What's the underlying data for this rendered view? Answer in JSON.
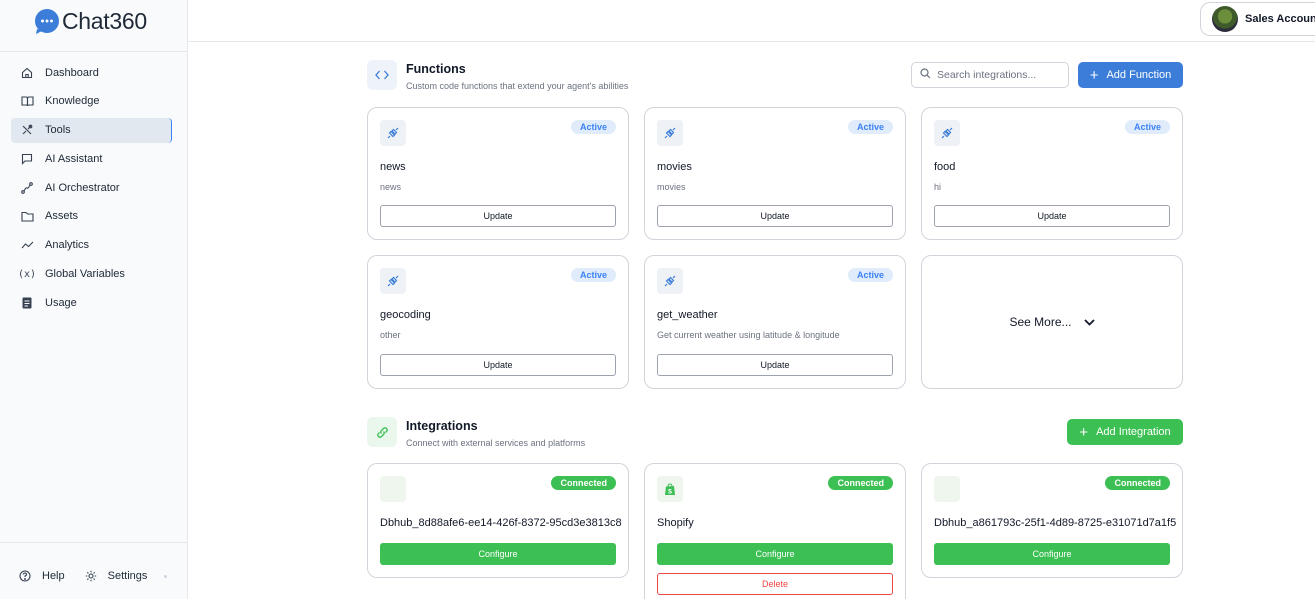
{
  "brand": {
    "name": "Chat360"
  },
  "sidebar": {
    "items": [
      {
        "label": "Dashboard",
        "icon": "home-icon"
      },
      {
        "label": "Knowledge",
        "icon": "book-icon"
      },
      {
        "label": "Tools",
        "icon": "tools-icon",
        "active": true
      },
      {
        "label": "AI Assistant",
        "icon": "chat-icon"
      },
      {
        "label": "AI Orchestrator",
        "icon": "workflow-icon"
      },
      {
        "label": "Assets",
        "icon": "folder-icon"
      },
      {
        "label": "Analytics",
        "icon": "trend-icon"
      },
      {
        "label": "Global Variables",
        "icon": "variable-icon"
      },
      {
        "label": "Usage",
        "icon": "doc-icon"
      }
    ],
    "help_label": "Help",
    "settings_label": "Settings"
  },
  "header": {
    "account_label": "Sales Account"
  },
  "functions": {
    "title": "Functions",
    "subtitle": "Custom code functions that extend your agent's abilities",
    "search_placeholder": "Search integrations...",
    "add_label": "Add Function",
    "cards": [
      {
        "name": "news",
        "description": "news",
        "status": "Active",
        "button": "Update"
      },
      {
        "name": "movies",
        "description": "movies",
        "status": "Active",
        "button": "Update"
      },
      {
        "name": "food",
        "description": "hi",
        "status": "Active",
        "button": "Update"
      },
      {
        "name": "geocoding",
        "description": "other",
        "status": "Active",
        "button": "Update"
      },
      {
        "name": "get_weather",
        "description": "Get current weather using latitude & longitude",
        "status": "Active",
        "button": "Update"
      }
    ],
    "see_more_label": "See More..."
  },
  "integrations": {
    "title": "Integrations",
    "subtitle": "Connect with external services and platforms",
    "add_label": "Add Integration",
    "cards": [
      {
        "name": "Dbhub_8d88afe6-ee14-426f-8372-95cd3e3813c8",
        "status": "Connected",
        "button": "Configure"
      },
      {
        "name": "Shopify",
        "status": "Connected",
        "button": "Configure",
        "delete_label": "Delete"
      },
      {
        "name": "Dbhub_a861793c-25f1-4d89-8725-e31071d7a1f5",
        "status": "Connected",
        "button": "Configure"
      }
    ]
  },
  "colors": {
    "primary": "#3b7dd8",
    "success": "#3cbf53",
    "danger": "#ef4444"
  }
}
